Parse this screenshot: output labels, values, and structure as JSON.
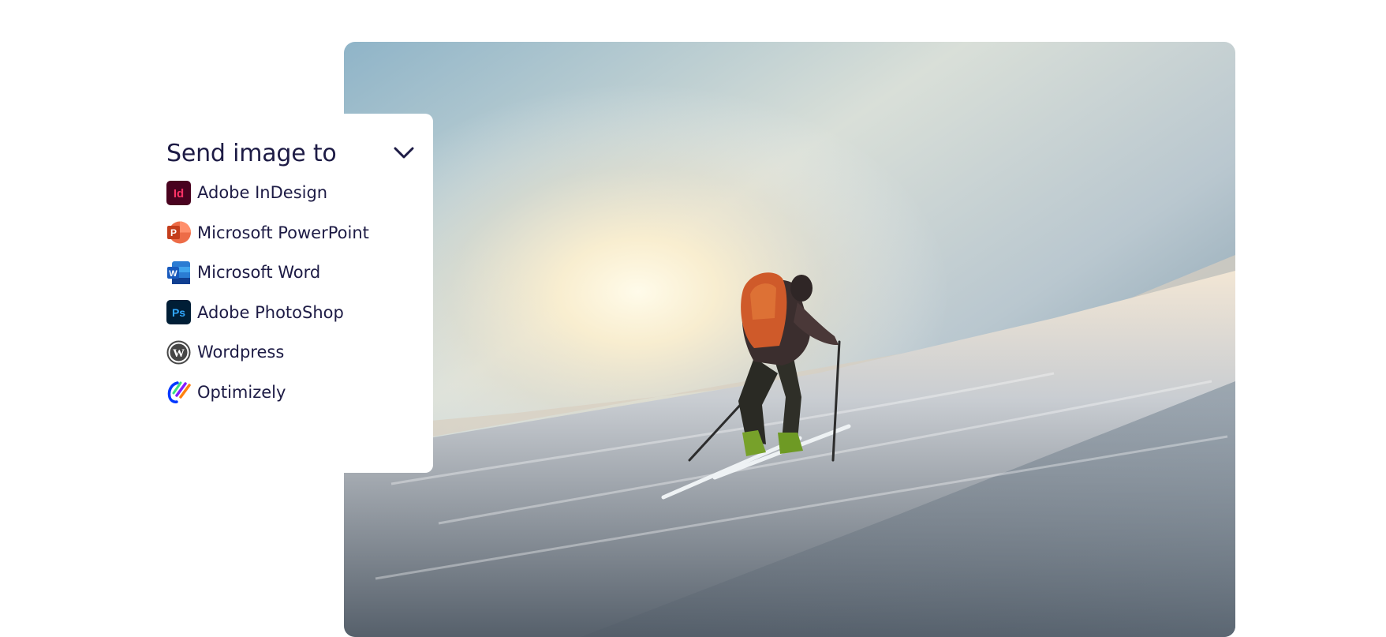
{
  "panel": {
    "title": "Send image to",
    "items": [
      {
        "label": "Adobe InDesign",
        "icon": "adobe-indesign-icon",
        "color": "#49021f"
      },
      {
        "label": "Microsoft PowerPoint",
        "icon": "microsoft-powerpoint-icon",
        "color": "#d24726"
      },
      {
        "label": "Microsoft Word",
        "icon": "microsoft-word-icon",
        "color": "#185abd"
      },
      {
        "label": "Adobe PhotoShop",
        "icon": "adobe-photoshop-icon",
        "color": "#001e36"
      },
      {
        "label": "Wordpress",
        "icon": "wordpress-icon",
        "color": "#464646"
      },
      {
        "label": "Optimizely",
        "icon": "optimizely-icon",
        "color": "#0037ff"
      }
    ]
  },
  "photo": {
    "subject": "skier-on-snowy-slope"
  },
  "colors": {
    "text": "#1d1b45",
    "background": "#ffffff"
  }
}
